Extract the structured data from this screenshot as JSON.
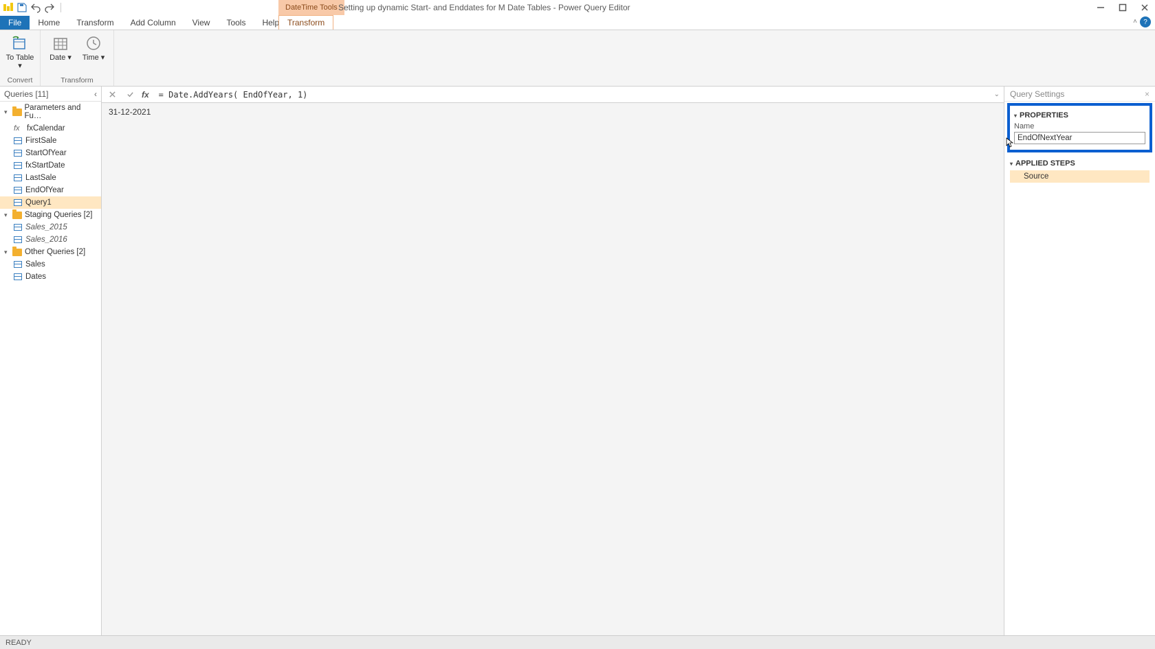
{
  "titlebar": {
    "contextual_label": "DateTime Tools",
    "document_title": "Setting up dynamic Start- and Enddates for M Date Tables - Power Query Editor"
  },
  "ribbon_tabs": {
    "file": "File",
    "home": "Home",
    "transform": "Transform",
    "add_column": "Add Column",
    "view": "View",
    "tools": "Tools",
    "help": "Help",
    "contextual": "Transform"
  },
  "ribbon": {
    "to_table_label": "To Table ▾",
    "date_label": "Date ▾",
    "time_label": "Time ▾",
    "group_convert": "Convert",
    "group_transform": "Transform"
  },
  "queries": {
    "header": "Queries [11]",
    "folders": [
      {
        "label": "Parameters and Fu…",
        "items": [
          {
            "label": "fxCalendar",
            "kind": "fx"
          },
          {
            "label": "FirstSale",
            "kind": "tbl"
          },
          {
            "label": "StartOfYear",
            "kind": "tbl"
          },
          {
            "label": "fxStartDate",
            "kind": "tbl"
          },
          {
            "label": "LastSale",
            "kind": "tbl"
          },
          {
            "label": "EndOfYear",
            "kind": "tbl"
          },
          {
            "label": "Query1",
            "kind": "tbl",
            "selected": true
          }
        ]
      },
      {
        "label": "Staging Queries [2]",
        "items": [
          {
            "label": "Sales_2015",
            "kind": "tbl-italic"
          },
          {
            "label": "Sales_2016",
            "kind": "tbl-italic"
          }
        ]
      },
      {
        "label": "Other Queries [2]",
        "items": [
          {
            "label": "Sales",
            "kind": "tbl"
          },
          {
            "label": "Dates",
            "kind": "tbl"
          }
        ]
      }
    ]
  },
  "formula_bar": {
    "text": "= Date.AddYears( EndOfYear, 1)"
  },
  "preview": {
    "value": "31-12-2021"
  },
  "settings": {
    "header": "Query Settings",
    "properties_title": "PROPERTIES",
    "name_label": "Name",
    "name_value": "EndOfNextYear",
    "applied_steps_title": "APPLIED STEPS",
    "steps": [
      "Source"
    ]
  },
  "statusbar": {
    "text": "READY"
  }
}
